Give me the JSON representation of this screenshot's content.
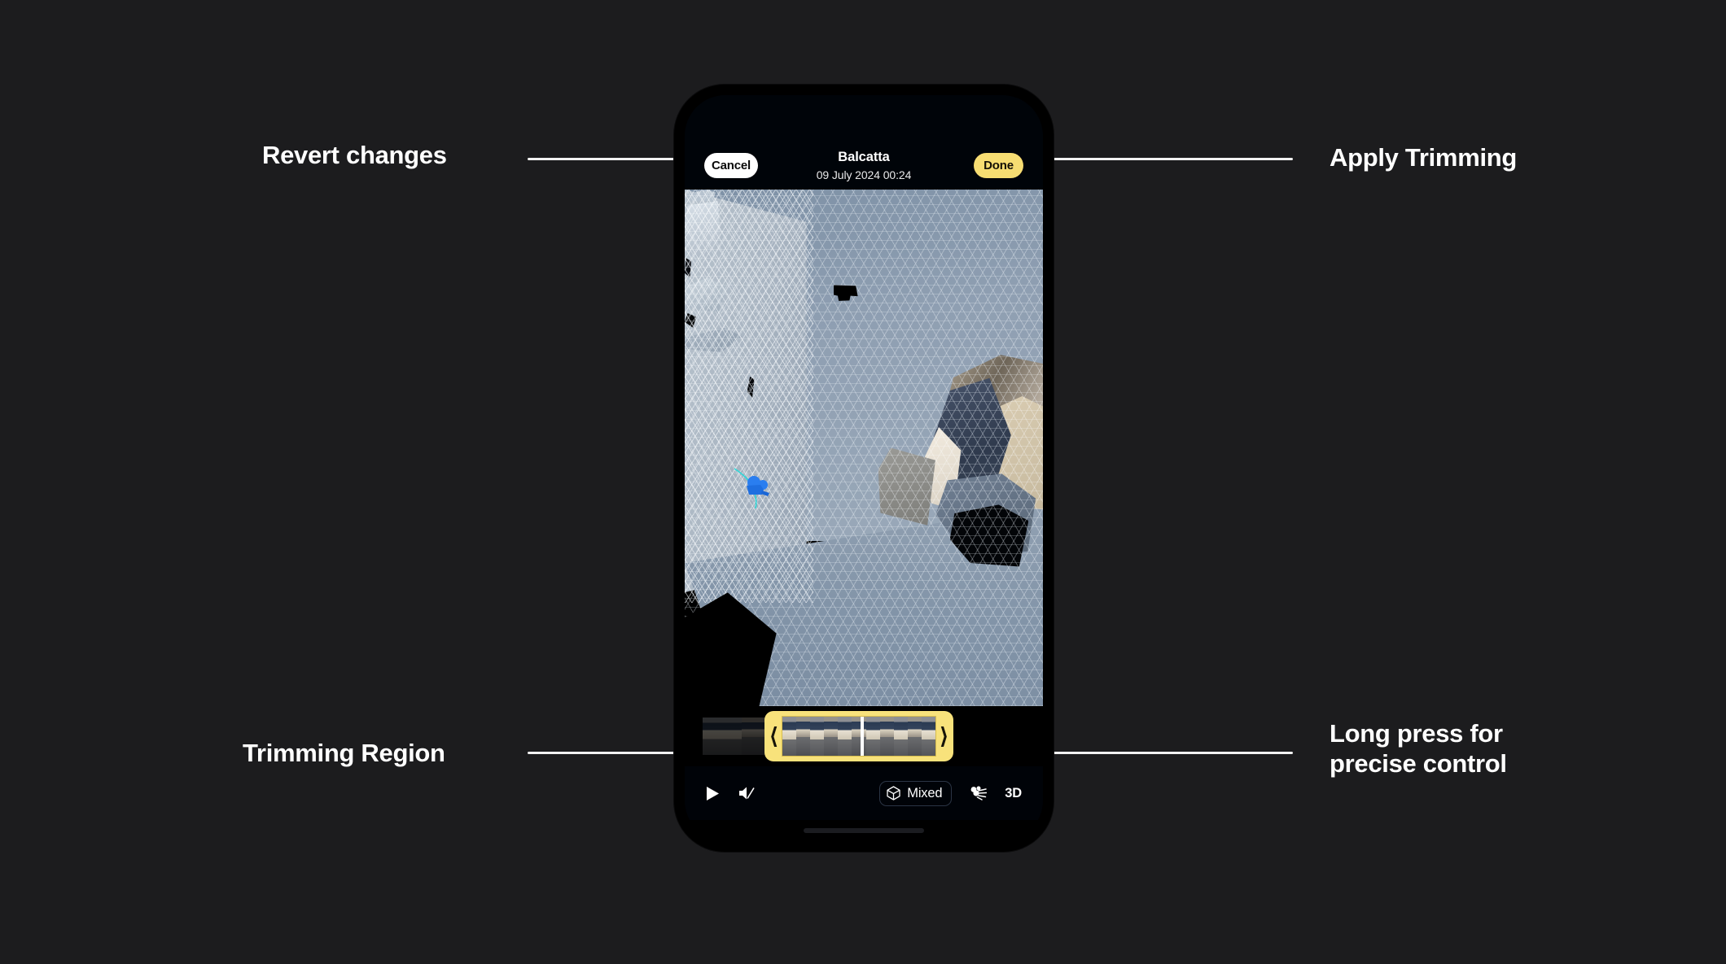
{
  "theme": {
    "page_background": "#1c1c1e",
    "annotation_text_color": "#ffffff",
    "leader_line_color": "#f2f2f2",
    "accent_yellow": "#f7dd72",
    "trim_yellow": "#f8e27b",
    "cancel_button_bg": "#ffffff",
    "playhead_color": "#ffffff",
    "marker_blue": "#2a7ef0",
    "trail_cyan": "#2fd8d8"
  },
  "annotations": [
    {
      "id": "revert-changes",
      "text": "Revert changes",
      "position": "top-left"
    },
    {
      "id": "apply-trimming",
      "text": "Apply Trimming",
      "position": "top-right"
    },
    {
      "id": "trimming-region",
      "text": "Trimming Region",
      "position": "bottom-left"
    },
    {
      "id": "precise-control",
      "text": "Long press for\nprecise control",
      "position": "bottom-right"
    }
  ],
  "phone": {
    "nav": {
      "title": "Balcatta",
      "subtitle": "09 July 2024 00:24",
      "cancel_label": "Cancel",
      "done_label": "Done"
    },
    "viewport": {
      "content_description": "3D scanned room mesh with triangulated wireframe overlay",
      "icons": {
        "camera_marker": "camera-path-marker-icon",
        "trail": "camera-trail-path"
      }
    },
    "trim": {
      "left_handle_icon": "chevron-left-handle-icon",
      "right_handle_icon": "chevron-right-handle-icon",
      "playhead_icon": "playhead-indicator",
      "selected_frames": 11,
      "dimmed_frames": 4
    },
    "toolbar": {
      "play_icon": "play-icon",
      "mute_icon": "mute-icon",
      "cube_icon": "cube-icon",
      "mixed_label": "Mixed",
      "splat_icon": "gaussian-splat-icon",
      "three_d_label": "3D"
    },
    "home_indicator": "home-indicator"
  }
}
